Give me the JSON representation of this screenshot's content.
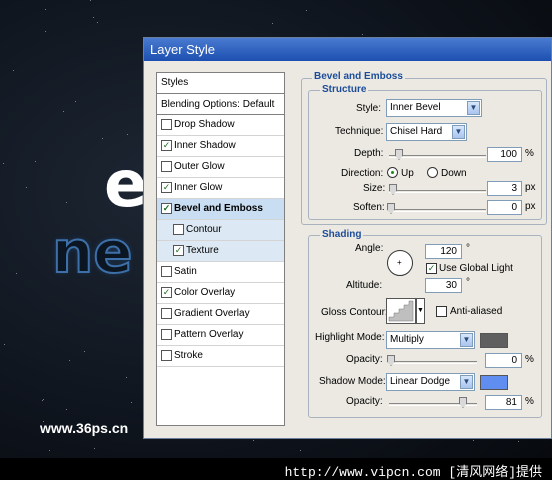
{
  "background": {
    "big_text_white": "e",
    "big_text_blue": "ne",
    "watermark": "www.36ps.cn",
    "bottom_caption": "http://www.vipcn.com [清风网络]提供"
  },
  "dialog": {
    "title": "Layer Style",
    "styles_header": "Styles",
    "blending_options": "Blending Options: Default",
    "styles": [
      {
        "label": "Drop Shadow",
        "checked": false
      },
      {
        "label": "Inner Shadow",
        "checked": true
      },
      {
        "label": "Outer Glow",
        "checked": false
      },
      {
        "label": "Inner Glow",
        "checked": true
      },
      {
        "label": "Bevel and Emboss",
        "checked": true,
        "selected": true
      },
      {
        "label": "Contour",
        "checked": false,
        "sub": true
      },
      {
        "label": "Texture",
        "checked": true,
        "sub": true
      },
      {
        "label": "Satin",
        "checked": false
      },
      {
        "label": "Color Overlay",
        "checked": true
      },
      {
        "label": "Gradient Overlay",
        "checked": false
      },
      {
        "label": "Pattern Overlay",
        "checked": false
      },
      {
        "label": "Stroke",
        "checked": false
      }
    ],
    "section_title": "Bevel and Emboss",
    "structure": {
      "title": "Structure",
      "style_label": "Style:",
      "style_value": "Inner Bevel",
      "technique_label": "Technique:",
      "technique_value": "Chisel Hard",
      "depth_label": "Depth:",
      "depth_value": "100",
      "depth_unit": "%",
      "direction_label": "Direction:",
      "direction_up": "Up",
      "direction_down": "Down",
      "size_label": "Size:",
      "size_value": "3",
      "size_unit": "px",
      "soften_label": "Soften:",
      "soften_value": "0",
      "soften_unit": "px"
    },
    "shading": {
      "title": "Shading",
      "angle_label": "Angle:",
      "angle_value": "120",
      "degree_symbol": "°",
      "use_global_light": "Use Global Light",
      "altitude_label": "Altitude:",
      "altitude_value": "30",
      "gloss_contour_label": "Gloss Contour:",
      "anti_aliased": "Anti-aliased",
      "highlight_mode_label": "Highlight Mode:",
      "highlight_mode_value": "Multiply",
      "highlight_color": "#5f5f5f",
      "highlight_opacity_label": "Opacity:",
      "highlight_opacity_value": "0",
      "shadow_mode_label": "Shadow Mode:",
      "shadow_mode_value": "Linear Dodge",
      "shadow_color": "#5f8ef0",
      "shadow_opacity_label": "Opacity:",
      "shadow_opacity_value": "81",
      "percent": "%"
    }
  }
}
